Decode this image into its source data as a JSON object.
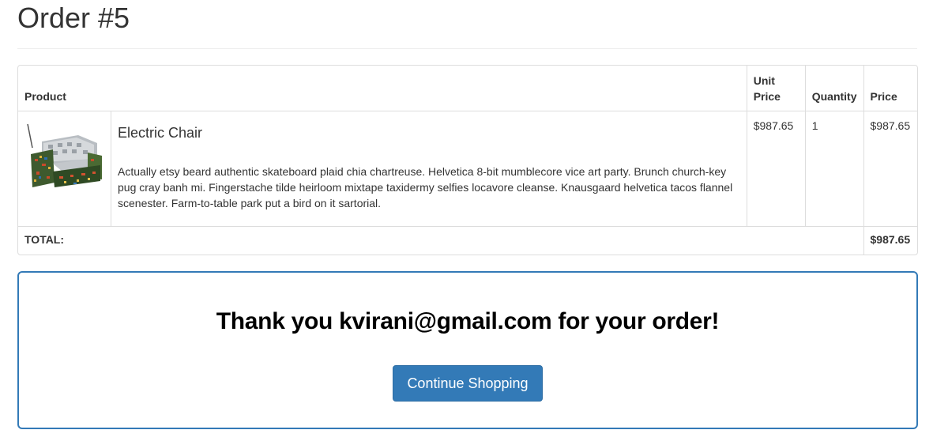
{
  "page": {
    "title": "Order #5"
  },
  "table": {
    "headers": {
      "product": "Product",
      "unit_price_line1": "Unit",
      "unit_price_line2": "Price",
      "quantity": "Quantity",
      "price": "Price"
    },
    "items": [
      {
        "name": "Electric Chair",
        "description": "Actually etsy beard authentic skateboard plaid chia chartreuse. Helvetica 8-bit mumblecore vice art party. Brunch church-key pug cray banh mi. Fingerstache tilde heirloom mixtape taxidermy selfies locavore cleanse. Knausgaard helvetica tacos flannel scenester. Farm-to-table park put a bird on it sartorial.",
        "unit_price": "$987.65",
        "quantity": "1",
        "price": "$987.65",
        "image_icon": "electric-chair-image"
      }
    ],
    "total_label": "TOTAL:",
    "total_value": "$987.65"
  },
  "thanks": {
    "message": "Thank you kvirani@gmail.com for your order!",
    "button_label": "Continue Shopping"
  },
  "colors": {
    "primary": "#337ab7",
    "border": "#dddddd",
    "text": "#333333"
  }
}
